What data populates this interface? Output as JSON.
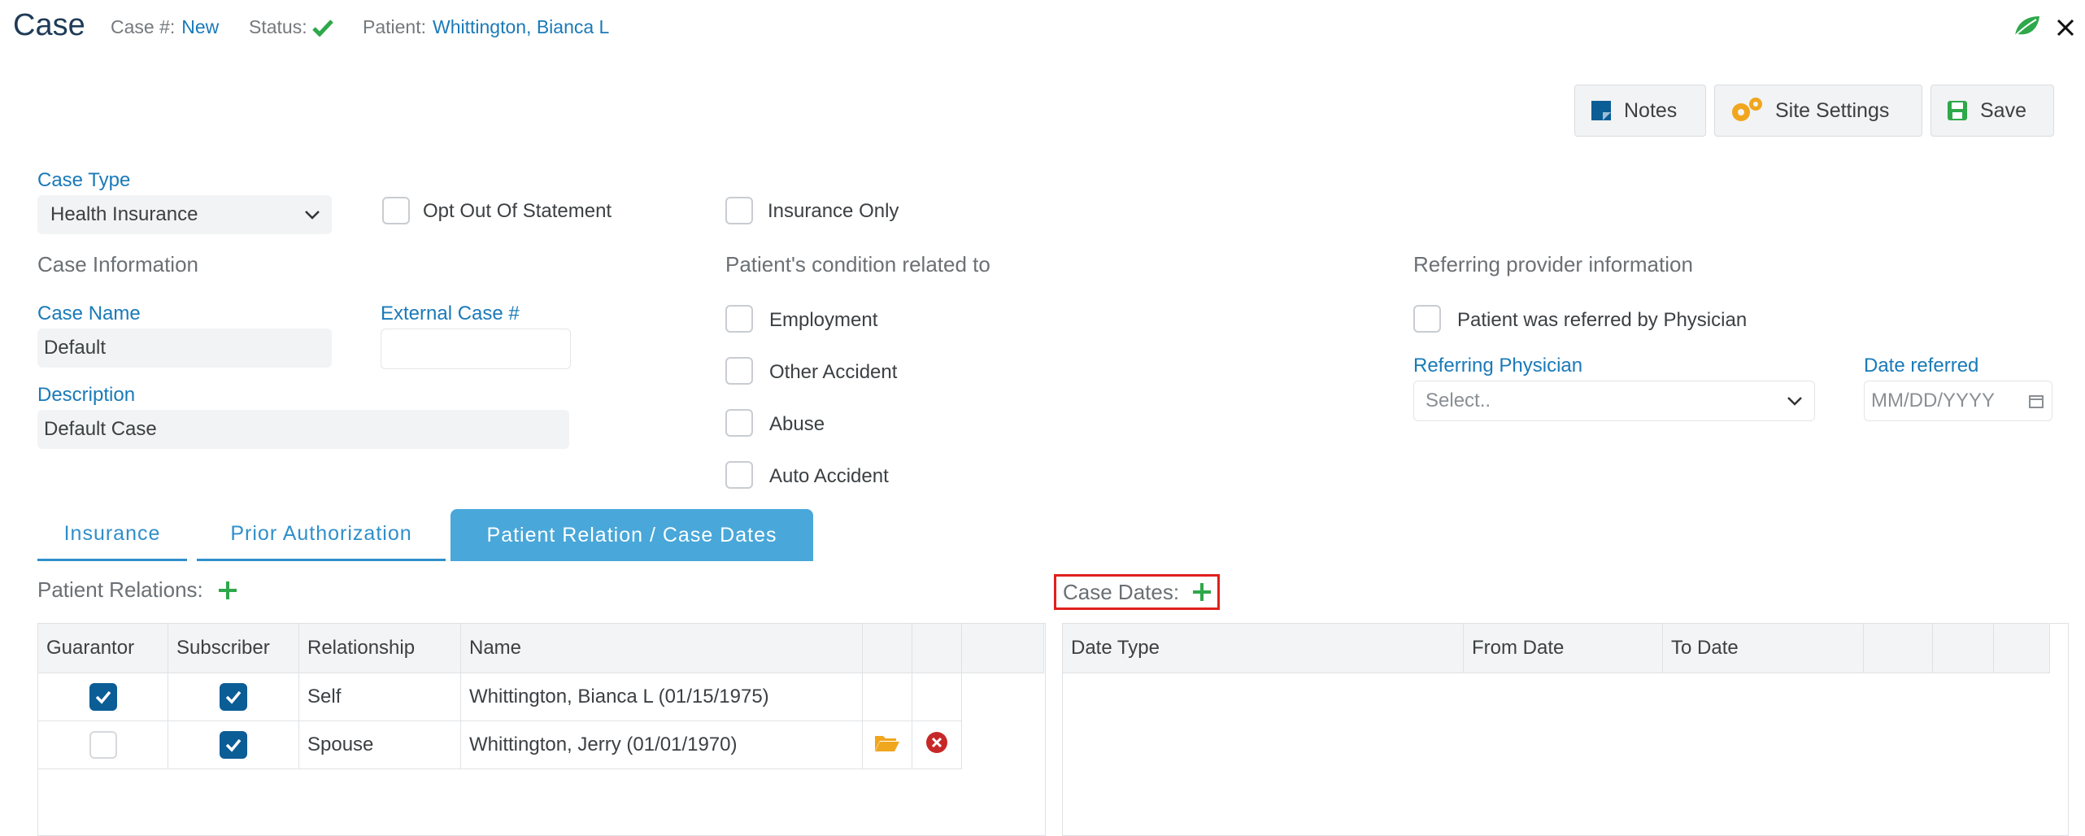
{
  "header": {
    "title": "Case",
    "case_no_label": "Case #:",
    "case_no_value": "New",
    "status_label": "Status:",
    "patient_label": "Patient:",
    "patient_value": "Whittington, Bianca L"
  },
  "toolbar": {
    "notes_label": "Notes",
    "site_settings_label": "Site Settings",
    "save_label": "Save"
  },
  "case_type": {
    "label": "Case Type",
    "value": "Health Insurance"
  },
  "opt_out": {
    "label": "Opt Out Of Statement",
    "checked": false
  },
  "insurance_only": {
    "label": "Insurance Only",
    "checked": false
  },
  "case_information": {
    "heading": "Case Information",
    "case_name_label": "Case Name",
    "case_name_value": "Default",
    "external_label": "External Case #",
    "external_value": "",
    "description_label": "Description",
    "description_value": "Default Case"
  },
  "condition": {
    "heading": "Patient's condition related to",
    "items": [
      {
        "label": "Employment",
        "checked": false
      },
      {
        "label": "Other Accident",
        "checked": false
      },
      {
        "label": "Abuse",
        "checked": false
      },
      {
        "label": "Auto Accident",
        "checked": false
      }
    ]
  },
  "referring": {
    "heading": "Referring provider information",
    "referred_label": "Patient was referred by Physician",
    "physician_label": "Referring Physician",
    "physician_placeholder": "Select..",
    "date_label": "Date referred",
    "date_placeholder": "MM/DD/YYYY"
  },
  "tabs": [
    {
      "label": "Insurance",
      "active": false
    },
    {
      "label": "Prior Authorization",
      "active": false
    },
    {
      "label": "Patient Relation / Case Dates",
      "active": true
    }
  ],
  "patient_relations": {
    "title": "Patient Relations:",
    "columns": [
      "Guarantor",
      "Subscriber",
      "Relationship",
      "Name"
    ],
    "rows": [
      {
        "guarantor": true,
        "subscriber": true,
        "relationship": "Self",
        "name": "Whittington, Bianca L (01/15/1975)"
      },
      {
        "guarantor": false,
        "subscriber": true,
        "relationship": "Spouse",
        "name": "Whittington, Jerry (01/01/1970)"
      }
    ]
  },
  "case_dates": {
    "title": "Case Dates:",
    "columns": [
      "Date Type",
      "From Date",
      "To Date"
    ]
  },
  "colors": {
    "accent": "#1a7ab8",
    "tab_active": "#49a7d9",
    "checkbox": "#0b5d96",
    "add": "#2ea84a",
    "highlight": "#e0201c"
  }
}
